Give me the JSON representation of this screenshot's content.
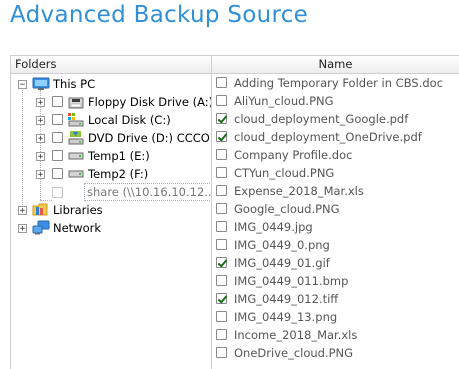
{
  "page": {
    "title": "Advanced Backup Source"
  },
  "columns": {
    "folders": "Folders",
    "name": "Name"
  },
  "tree": {
    "this_pc": "This PC",
    "floppy": "Floppy Disk Drive (A:)",
    "local_disk": "Local Disk (C:)",
    "dvd": "DVD Drive (D:) CCCOM",
    "temp1": "Temp1 (E:)",
    "temp2": "Temp2 (F:)",
    "share": "share (\\\\10.16.10.12...",
    "libraries": "Libraries",
    "network": "Network"
  },
  "files": [
    {
      "name": "Adding Temporary Folder in CBS.doc",
      "checked": false
    },
    {
      "name": "AliYun_cloud.PNG",
      "checked": false
    },
    {
      "name": "cloud_deployment_Google.pdf",
      "checked": true
    },
    {
      "name": "cloud_deployment_OneDrive.pdf",
      "checked": true
    },
    {
      "name": "Company Profile.doc",
      "checked": false
    },
    {
      "name": "CTYun_cloud.PNG",
      "checked": false
    },
    {
      "name": "Expense_2018_Mar.xls",
      "checked": false
    },
    {
      "name": "Google_cloud.PNG",
      "checked": false
    },
    {
      "name": "IMG_0449.jpg",
      "checked": false
    },
    {
      "name": "IMG_0449_0.png",
      "checked": false
    },
    {
      "name": "IMG_0449_01.gif",
      "checked": true
    },
    {
      "name": "IMG_0449_011.bmp",
      "checked": false
    },
    {
      "name": "IMG_0449_012.tiff",
      "checked": true
    },
    {
      "name": "IMG_0449_13.png",
      "checked": false
    },
    {
      "name": "Income_2018_Mar.xls",
      "checked": false
    },
    {
      "name": "OneDrive_cloud.PNG",
      "checked": false
    }
  ]
}
